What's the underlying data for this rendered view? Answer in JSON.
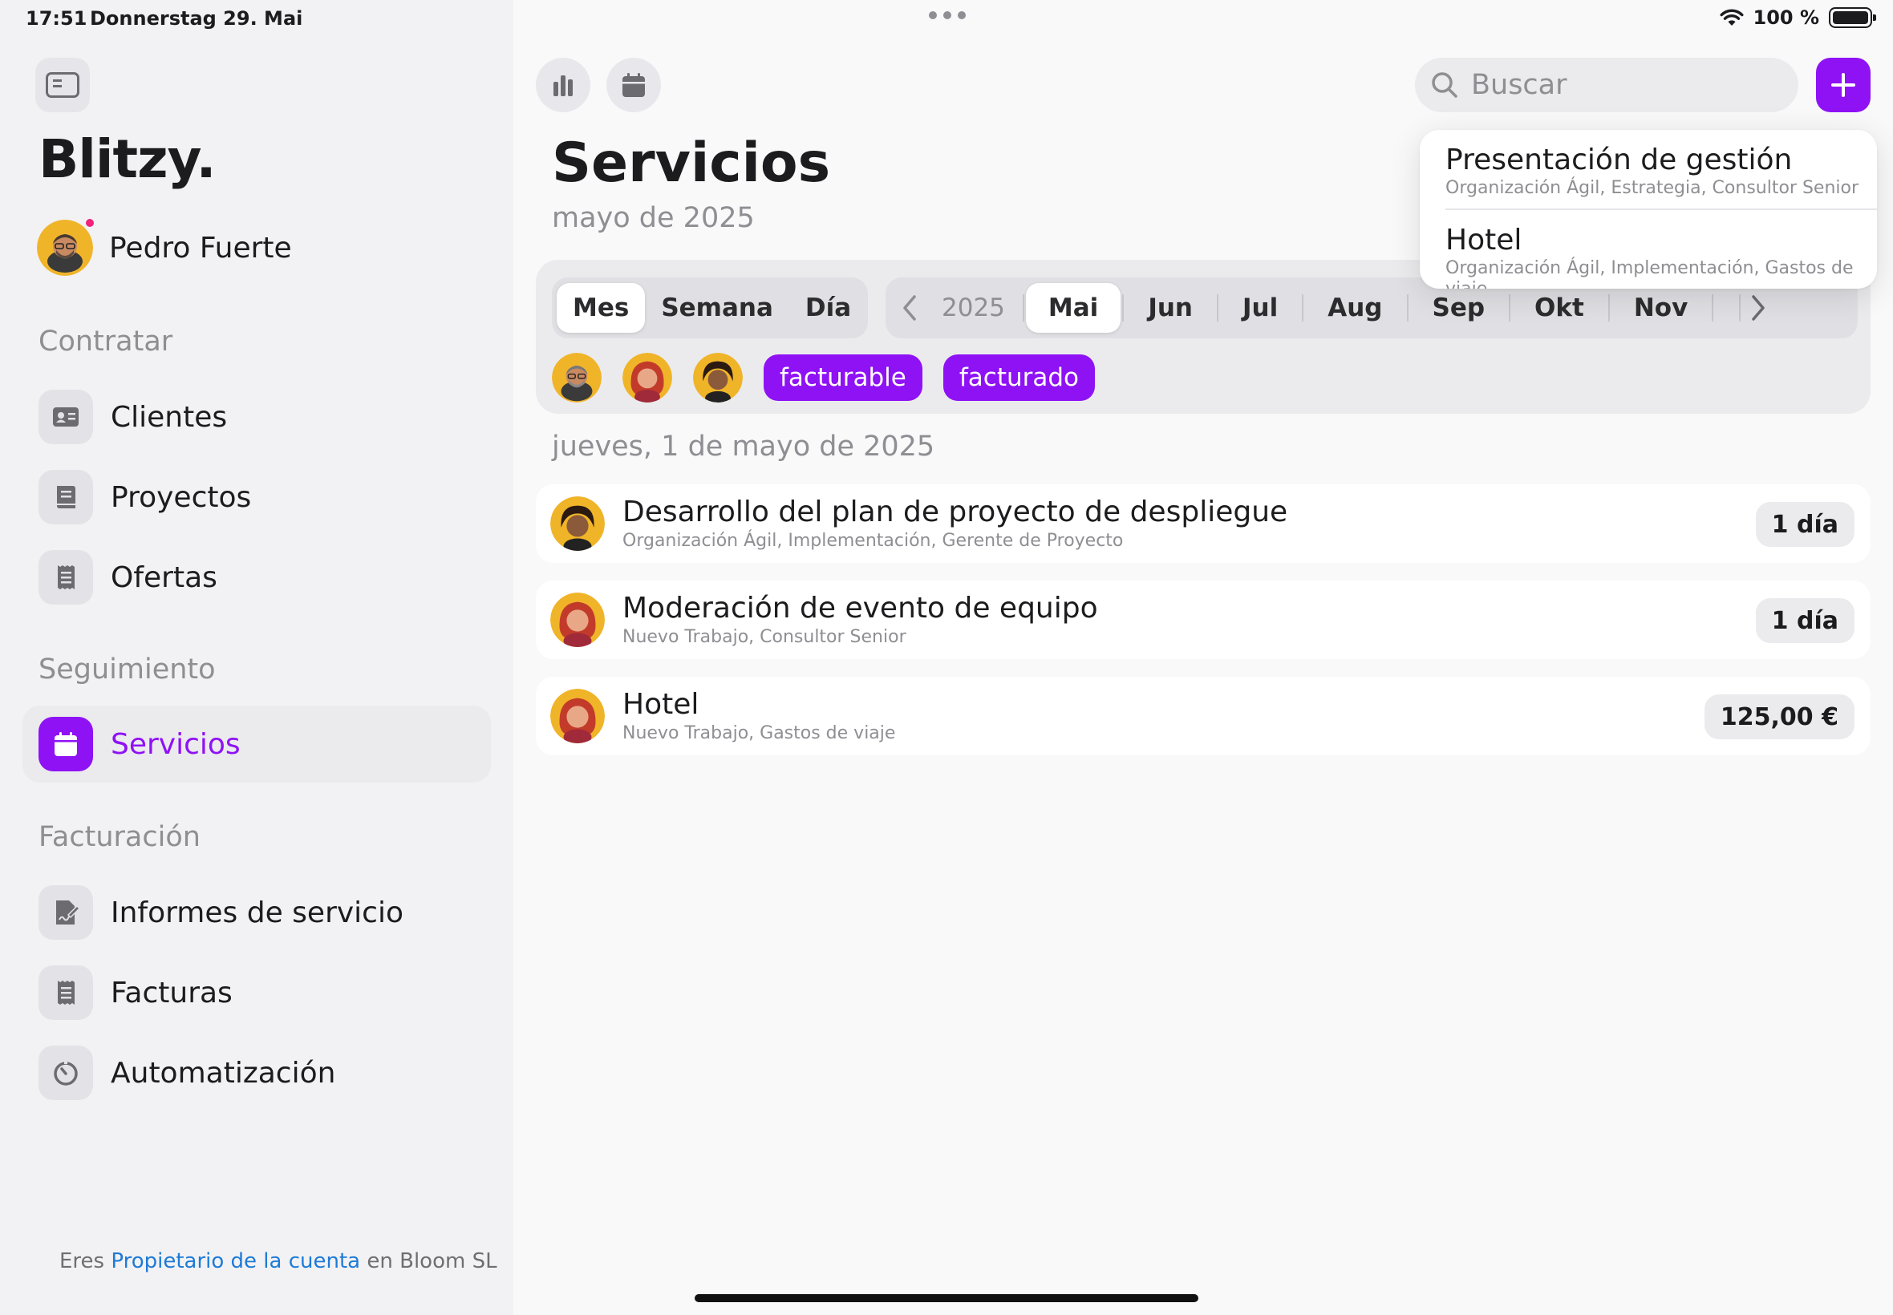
{
  "status": {
    "time": "17:51",
    "date": "Donnerstag 29. Mai",
    "battery": "100 %"
  },
  "sidebar": {
    "brand": "Blitzy.",
    "user_name": "Pedro Fuerte",
    "sections": [
      {
        "title": "Contratar"
      },
      {
        "title": "Seguimiento"
      },
      {
        "title": "Facturación"
      }
    ],
    "items": [
      {
        "label": "Clientes",
        "icon": "contact-card-icon"
      },
      {
        "label": "Proyectos",
        "icon": "book-icon"
      },
      {
        "label": "Ofertas",
        "icon": "receipt-icon"
      },
      {
        "label": "Servicios",
        "icon": "calendar-icon",
        "active": true
      },
      {
        "label": "Informes de servicio",
        "icon": "signed-document-icon"
      },
      {
        "label": "Facturas",
        "icon": "invoice-icon"
      },
      {
        "label": "Automatización",
        "icon": "timer-icon"
      }
    ],
    "footer": {
      "prefix": "Eres ",
      "link": "Propietario de la cuenta",
      "suffix": " en Bloom SL"
    }
  },
  "toolbar": {
    "search_placeholder": "Buscar"
  },
  "page": {
    "title": "Servicios",
    "subtitle": "mayo de 2025"
  },
  "view_modes": [
    "Mes",
    "Semana",
    "Día"
  ],
  "months": {
    "year": "2025",
    "items": [
      "Mai",
      "Jun",
      "Jul",
      "Aug",
      "Sep",
      "Okt",
      "Nov"
    ],
    "selected": "Mai"
  },
  "filters": {
    "chips": [
      "facturable",
      "facturado"
    ]
  },
  "day_header": "jueves, 1 de mayo de 2025",
  "entries": [
    {
      "title": "Desarrollo del plan de proyecto de despliegue",
      "subtitle": "Organización Ágil, Implementación, Gerente de Proyecto",
      "badge": "1 día"
    },
    {
      "title": "Moderación de evento de equipo",
      "subtitle": "Nuevo Trabajo, Consultor Senior",
      "badge": "1 día"
    },
    {
      "title": "Hotel",
      "subtitle": "Nuevo Trabajo, Gastos de viaje",
      "badge": "125,00 €"
    }
  ],
  "dropdown": [
    {
      "title": "Presentación de gestión",
      "subtitle": "Organización Ágil, Estrategia, Consultor Senior"
    },
    {
      "title": "Hotel",
      "subtitle": "Organización Ágil, Implementación, Gastos de viaje"
    }
  ],
  "colors": {
    "accent": "#8f12f5",
    "link": "#1e7ad6",
    "notification": "#f0227a"
  }
}
